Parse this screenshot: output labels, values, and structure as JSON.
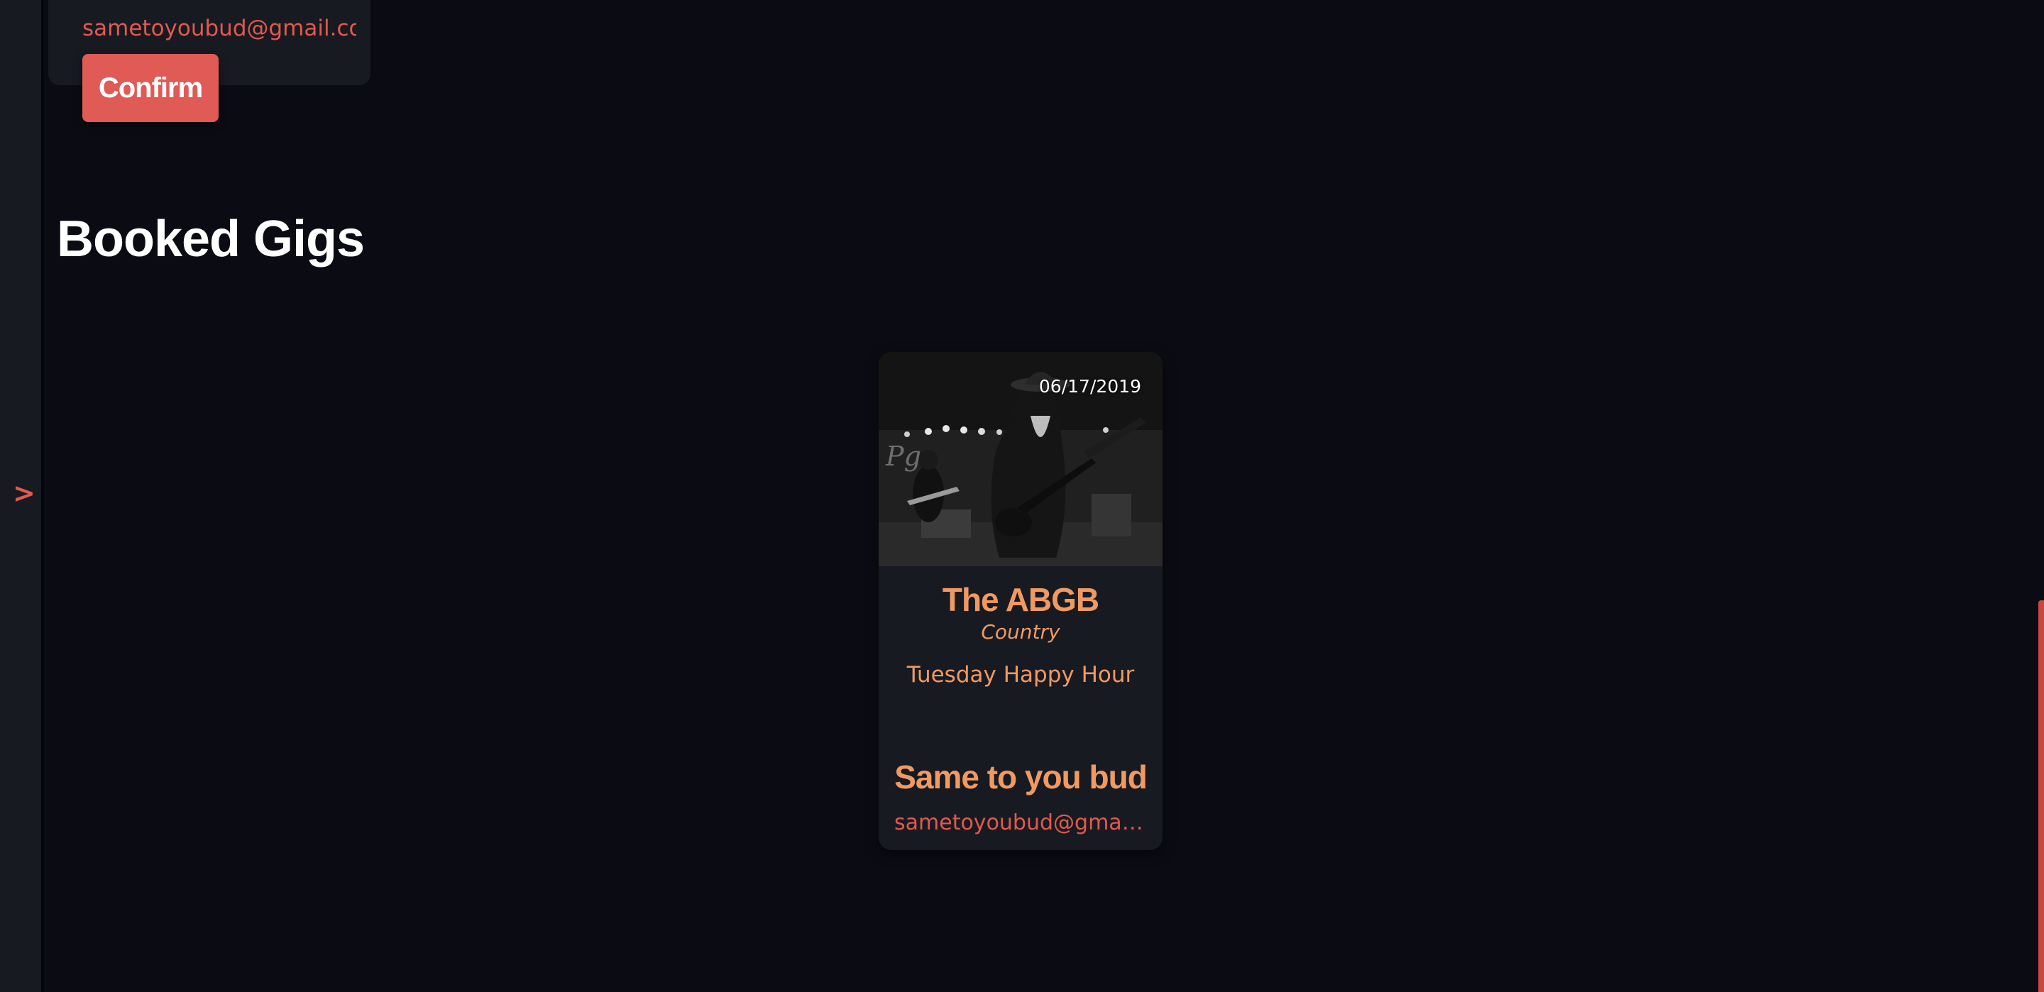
{
  "sidebar": {
    "toggle_label": ">"
  },
  "top_card": {
    "email": "sametoyoubud@gmail.com",
    "confirm_label": "Confirm"
  },
  "booked_gigs": {
    "title": "Booked Gigs",
    "gigs": [
      {
        "date": "06/17/2019",
        "venue": "The ABGB",
        "genre": "Country",
        "event": "Tuesday Happy Hour",
        "artist": "Same to you bud",
        "email": "sametoyoubud@gmail.com"
      }
    ]
  },
  "colors": {
    "background": "#0b0c13",
    "card": "#181a22",
    "accent_red": "#e05a56",
    "accent_orange": "#f09a62"
  }
}
